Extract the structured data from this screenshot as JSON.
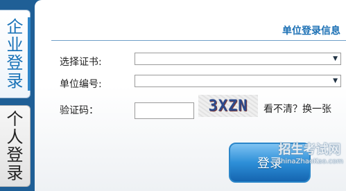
{
  "tabs": {
    "company": [
      "企",
      "业",
      "登",
      "录"
    ],
    "personal": [
      "个",
      "人",
      "登",
      "录"
    ]
  },
  "panel": {
    "title": "单位登录信息",
    "select_cert_label": "选择证书:",
    "select_cert_value": "",
    "unit_no_label": "单位编号:",
    "unit_no_value": "",
    "captcha_label": "验证码：",
    "captcha_value": "",
    "captcha_text": "3XZN",
    "refresh_text": "看不清？换一张",
    "login_label": "登录"
  },
  "watermark": {
    "main": "招生考试网",
    "sub": "ChinaZhaoKao.com"
  },
  "colors": {
    "accent": "#1a6fb4",
    "background": "#1f5f96"
  }
}
